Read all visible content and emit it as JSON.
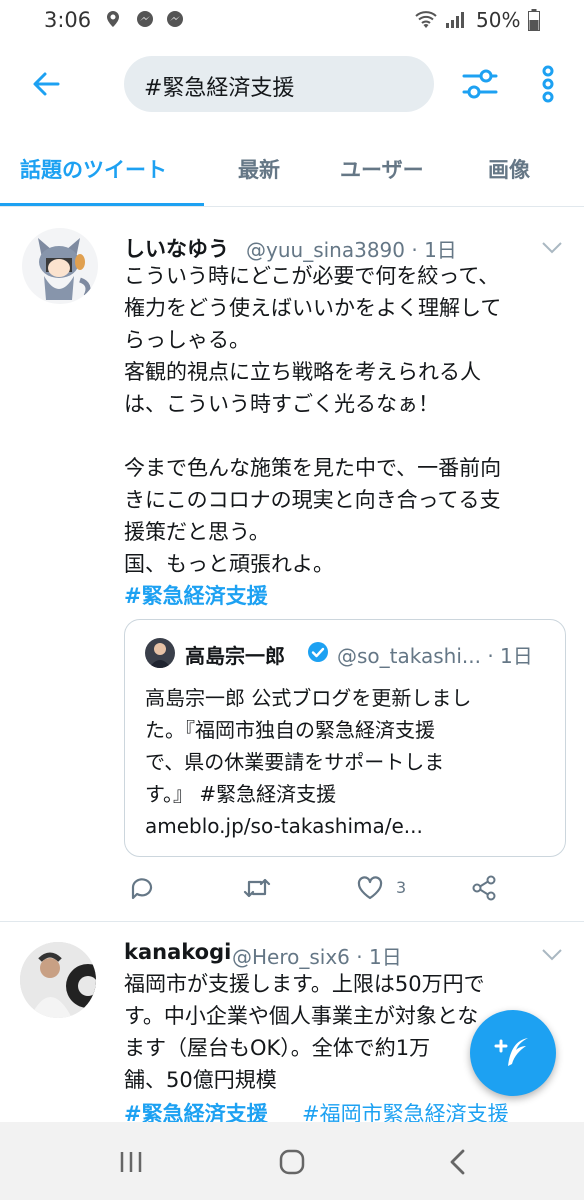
{
  "status_bar": {
    "time": "3:06",
    "battery": "50%"
  },
  "search": {
    "query": "#緊急経済支援"
  },
  "tabs": [
    {
      "label": "話題のツイート",
      "active": true
    },
    {
      "label": "最新"
    },
    {
      "label": "ユーザー"
    },
    {
      "label": "画像"
    }
  ],
  "tweet1": {
    "name": "しいなゆう",
    "meta": "@yuu_sina3890 · 1日",
    "text": "こういう時にどこが必要で何を絞って、\n権力をどう使えばいいかをよく理解して\nらっしゃる。\n客観的視点に立ち戦略を考えられる人\nは、こういう時すごく光るなぁ！\n\n今まで色んな施策を見た中で、一番前向\nきにこのコロナの現実と向き合ってる支\n援策だと思う。\n国、もっと頑張れよ。",
    "hashtag": "#緊急経済支援",
    "quote": {
      "name": "高島宗一郎",
      "meta": "@so_takashi... · 1日",
      "text": "高島宗一郎 公式ブログを更新しまし\nた。『福岡市独自の緊急経済支援\nで、県の休業要請をサポートしま\nす。』 #緊急経済支援\nameblo.jp/so-takashima/e..."
    },
    "like_count": "3"
  },
  "tweet2": {
    "name": "kanakogi",
    "meta": "@Hero_six6 · 1日",
    "text": "福岡市が支援します。上限は50万円で\nす。中小企業や個人事業主が対象とな\nます（屋台もOK）。全体で約1万\n舗、50億円規模",
    "hashtag1": "#緊急経済支援",
    "hashtag2": "#福岡市緊急経済支援"
  },
  "colors": {
    "accent": "#1da1f2",
    "secondary_text": "#657786"
  }
}
